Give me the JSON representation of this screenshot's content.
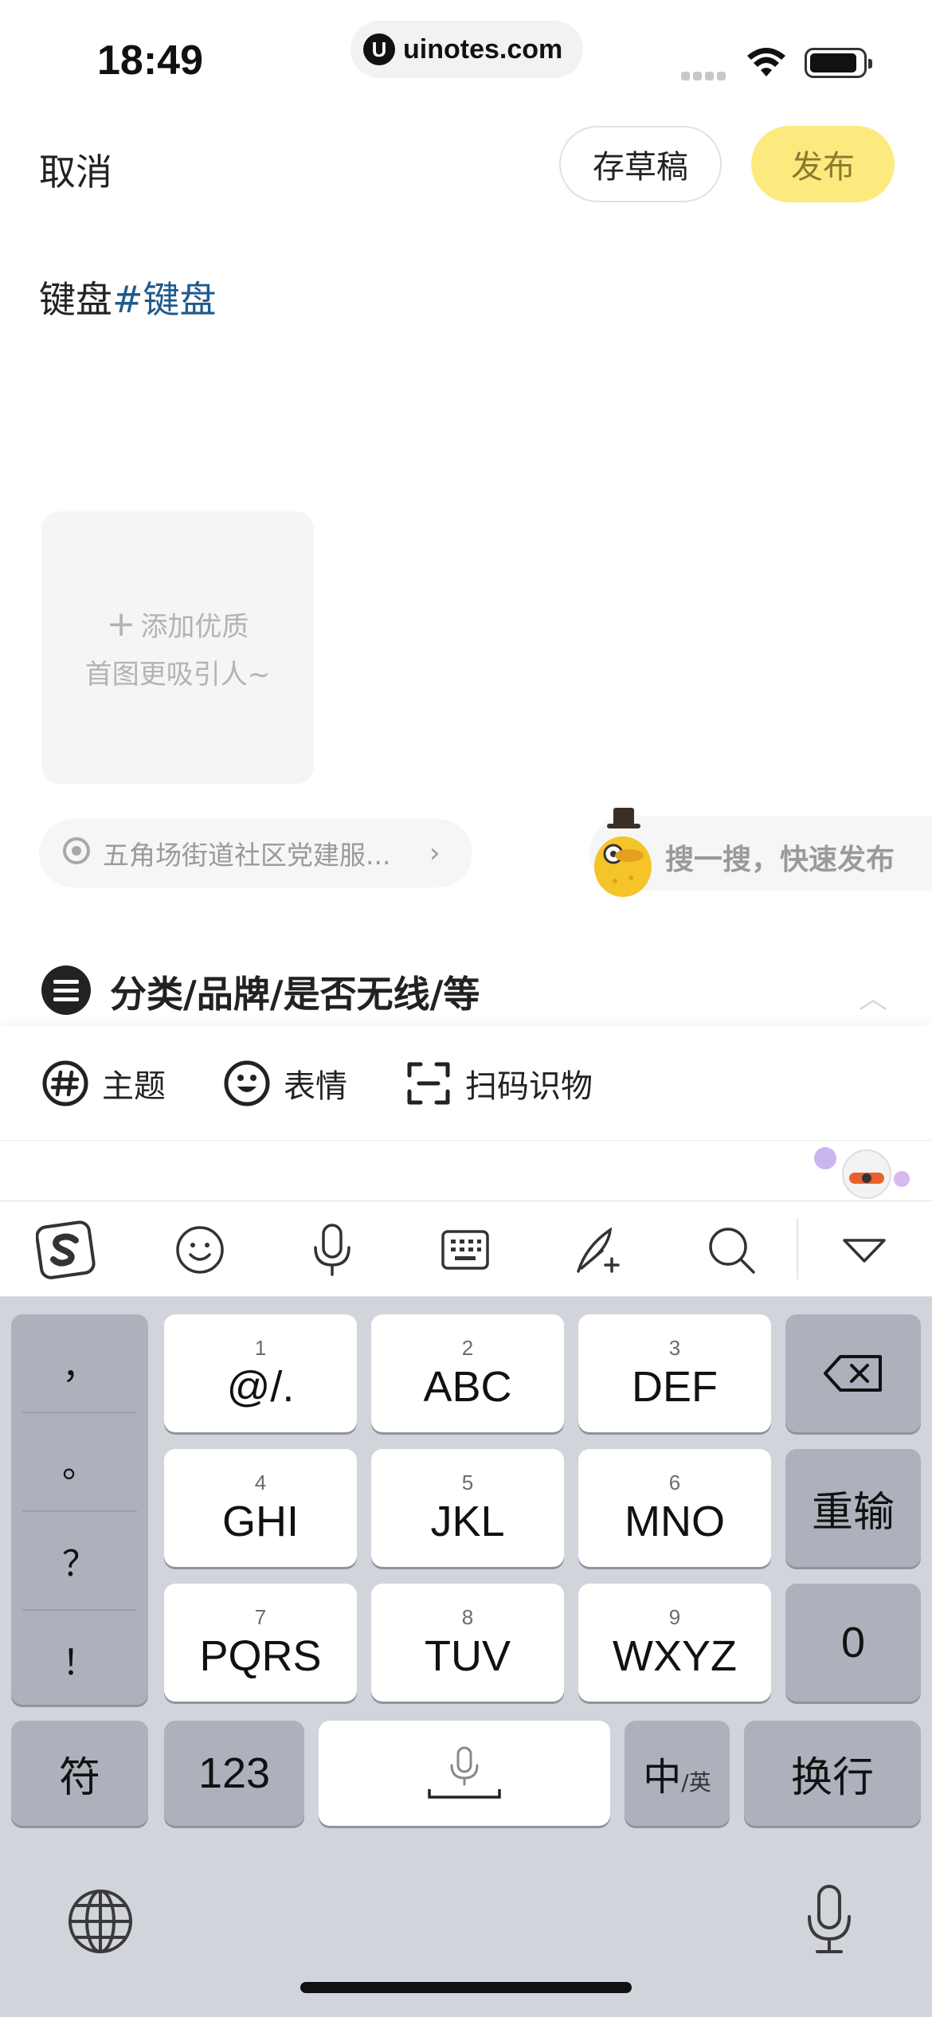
{
  "status_bar": {
    "time": "18:49",
    "url_logo": "U",
    "url": "uinotes.com",
    "icons": [
      "signal-icon",
      "wifi-icon",
      "battery-icon"
    ]
  },
  "header": {
    "cancel_label": "取消",
    "draft_label": "存草稿",
    "publish_label": "发布"
  },
  "composer": {
    "text": "键盘",
    "hashtag": "#键盘"
  },
  "image_placeholder": {
    "line1": "添加优质",
    "line2": "首图更吸引人~",
    "plus": "+"
  },
  "location": {
    "label": "五角场街道社区党建服...",
    "chevron": "›"
  },
  "quick_publish": {
    "label": "搜一搜，快速发布"
  },
  "category": {
    "label": "分类/品牌/是否无线/等",
    "chevron": "︿"
  },
  "toolbar": {
    "items": [
      {
        "label": "主题",
        "icon": "hashtag-icon"
      },
      {
        "label": "表情",
        "icon": "emoji-icon"
      },
      {
        "label": "扫码识物",
        "icon": "scan-icon"
      }
    ]
  },
  "keyboard_toolbar": {
    "tools": [
      "sogou-logo-icon",
      "emoji-icon",
      "microphone-icon",
      "keyboard-icon",
      "handwriting-icon",
      "search-icon",
      "collapse-icon"
    ]
  },
  "keyboard": {
    "punctuation": [
      "，",
      "。",
      "？",
      "！"
    ],
    "keys": [
      {
        "num": "1",
        "label": "@/."
      },
      {
        "num": "2",
        "label": "ABC"
      },
      {
        "num": "3",
        "label": "DEF"
      },
      {
        "num": "4",
        "label": "GHI"
      },
      {
        "num": "5",
        "label": "JKL"
      },
      {
        "num": "6",
        "label": "MNO"
      },
      {
        "num": "7",
        "label": "PQRS"
      },
      {
        "num": "8",
        "label": "TUV"
      },
      {
        "num": "9",
        "label": "WXYZ"
      }
    ],
    "reenter_label": "重输",
    "zero_label": "0",
    "symbol_label": "符",
    "num_label": "123",
    "lang_main": "中",
    "lang_sub": "/英",
    "return_label": "换行"
  },
  "colors": {
    "publish_bg": "#fdea7e",
    "hashtag": "#1f5a8c",
    "keyboard_bg": "#d2d4db",
    "key_gray": "#acb1bb"
  }
}
